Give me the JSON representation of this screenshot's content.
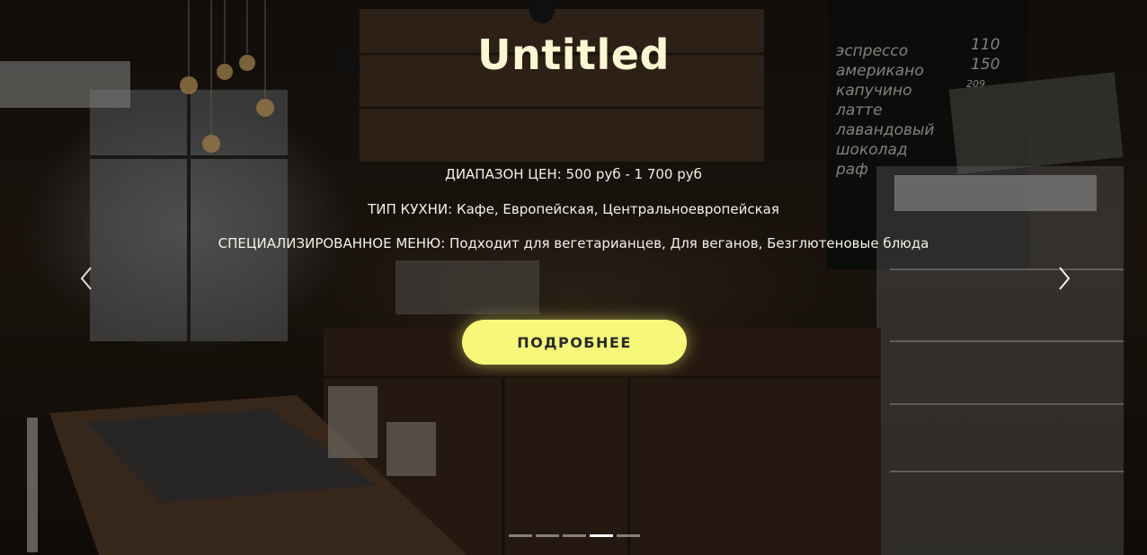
{
  "hero": {
    "title": "Untitled",
    "price_range": "ДИАПАЗОН ЦЕН: 500 руб - 1 700 руб",
    "cuisine": "ТИП КУХНИ: Кафе, Европейская, Центральноевропейская",
    "special_menu": "СПЕЦИАЛИЗИРОВАННОЕ МЕНЮ: Подходит для вегетарианцев, Для веганов, Безглютеновые блюда",
    "cta_label": "ПОДРОБНЕЕ"
  },
  "carousel": {
    "prev_icon": "chevron-left-icon",
    "next_icon": "chevron-right-icon",
    "slide_count": 5,
    "active_slide": 4
  },
  "background": {
    "description_icon": "cafe-interior-photo",
    "chalkboard_menu": [
      "эспрессо",
      "американо",
      "капучино",
      "латте",
      "лавандовый",
      "шоколад",
      "раф"
    ],
    "chalkboard_prices": [
      "110",
      "150",
      "209"
    ]
  },
  "colors": {
    "cta_background": "#f7f77a",
    "title_color": "#fdf6d3",
    "text_color": "#f5f1e6"
  }
}
